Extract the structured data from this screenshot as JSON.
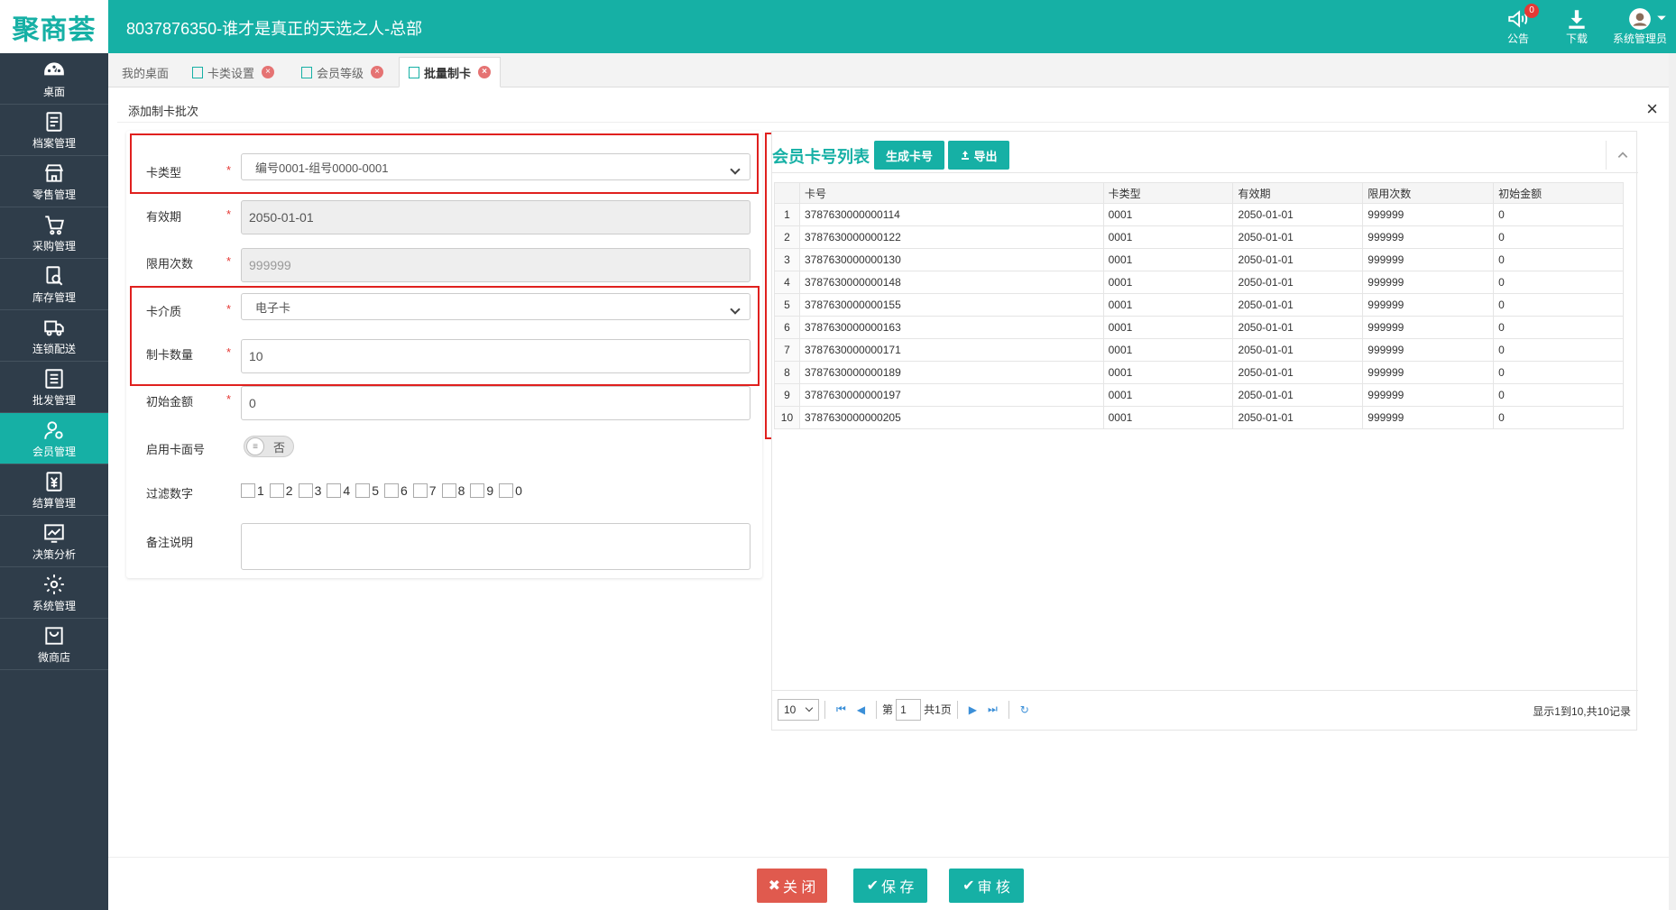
{
  "app": {
    "logo_text": "聚商荟",
    "title": "8037876350-谁才是真正的天选之人-总部"
  },
  "header": {
    "announce_label": "公告",
    "announce_count": "0",
    "download_label": "下载",
    "user_label": "系统管理员"
  },
  "sidebar": {
    "items": [
      {
        "label": "桌面",
        "icon": "dashboard-icon"
      },
      {
        "label": "档案管理",
        "icon": "archive-icon"
      },
      {
        "label": "零售管理",
        "icon": "store-icon"
      },
      {
        "label": "采购管理",
        "icon": "cart-icon"
      },
      {
        "label": "库存管理",
        "icon": "inventory-icon"
      },
      {
        "label": "连锁配送",
        "icon": "delivery-icon"
      },
      {
        "label": "批发管理",
        "icon": "wholesale-icon"
      },
      {
        "label": "会员管理",
        "icon": "member-icon"
      },
      {
        "label": "结算管理",
        "icon": "settlement-icon"
      },
      {
        "label": "决策分析",
        "icon": "chart-icon"
      },
      {
        "label": "系统管理",
        "icon": "gear-icon"
      },
      {
        "label": "微商店",
        "icon": "shop-icon"
      }
    ]
  },
  "tabs": [
    {
      "label": "我的桌面"
    },
    {
      "label": "卡类设置"
    },
    {
      "label": "会员等级"
    },
    {
      "label": "批量制卡"
    }
  ],
  "panel": {
    "title": "添加制卡批次",
    "close": "×"
  },
  "form": {
    "card_type": {
      "label": "卡类型",
      "value": "编号0001-组号0000-0001"
    },
    "validity": {
      "label": "有效期",
      "value": "2050-01-01"
    },
    "limit_times": {
      "label": "限用次数",
      "placeholder": "999999"
    },
    "medium": {
      "label": "卡介质",
      "value": "电子卡"
    },
    "quantity": {
      "label": "制卡数量",
      "value": "10"
    },
    "initial_amount": {
      "label": "初始金额",
      "value": "0"
    },
    "card_face": {
      "label": "启用卡面号",
      "toggle": "否"
    },
    "filter_digits": {
      "label": "过滤数字",
      "digits": [
        "1",
        "2",
        "3",
        "4",
        "5",
        "6",
        "7",
        "8",
        "9",
        "0"
      ]
    },
    "remark": {
      "label": "备注说明",
      "value": ""
    }
  },
  "grid": {
    "title": "会员卡号列表",
    "generate_btn": "生成卡号",
    "export_btn": "导出",
    "columns": [
      "卡号",
      "卡类型",
      "有效期",
      "限用次数",
      "初始金额"
    ],
    "rows": [
      [
        "1",
        "3787630000000114",
        "0001",
        "2050-01-01",
        "999999",
        "0"
      ],
      [
        "2",
        "3787630000000122",
        "0001",
        "2050-01-01",
        "999999",
        "0"
      ],
      [
        "3",
        "3787630000000130",
        "0001",
        "2050-01-01",
        "999999",
        "0"
      ],
      [
        "4",
        "3787630000000148",
        "0001",
        "2050-01-01",
        "999999",
        "0"
      ],
      [
        "5",
        "3787630000000155",
        "0001",
        "2050-01-01",
        "999999",
        "0"
      ],
      [
        "6",
        "3787630000000163",
        "0001",
        "2050-01-01",
        "999999",
        "0"
      ],
      [
        "7",
        "3787630000000171",
        "0001",
        "2050-01-01",
        "999999",
        "0"
      ],
      [
        "8",
        "3787630000000189",
        "0001",
        "2050-01-01",
        "999999",
        "0"
      ],
      [
        "9",
        "3787630000000197",
        "0001",
        "2050-01-01",
        "999999",
        "0"
      ],
      [
        "10",
        "3787630000000205",
        "0001",
        "2050-01-01",
        "999999",
        "0"
      ]
    ],
    "pager": {
      "page_size": "10",
      "page_prefix": "第",
      "page": "1",
      "total_pages": "共1页",
      "info": "显示1到10,共10记录"
    }
  },
  "footer": {
    "close_btn": "关 闭",
    "save_btn": "保 存",
    "audit_btn": "审 核"
  },
  "colors": {
    "accent": "#16b0a5",
    "sidebar": "#2f3d4a",
    "highlight": "#e0201e",
    "close_btn": "#e05a4e"
  }
}
